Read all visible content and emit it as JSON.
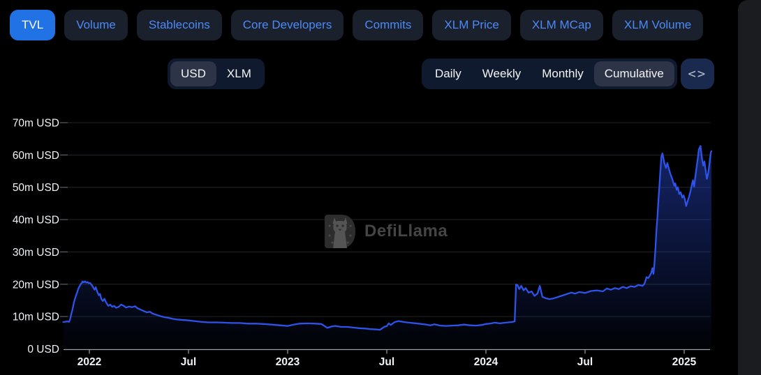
{
  "page": {
    "background": "#000000"
  },
  "tabs": [
    {
      "label": "TVL",
      "active": true
    },
    {
      "label": "Volume",
      "active": false
    },
    {
      "label": "Stablecoins",
      "active": false
    },
    {
      "label": "Core Developers",
      "active": false
    },
    {
      "label": "Commits",
      "active": false
    },
    {
      "label": "XLM Price",
      "active": false
    },
    {
      "label": "XLM MCap",
      "active": false
    },
    {
      "label": "XLM Volume",
      "active": false
    }
  ],
  "currency_toggle": {
    "options": [
      "USD",
      "XLM"
    ],
    "selected": "USD"
  },
  "interval_toggle": {
    "options": [
      "Daily",
      "Weekly",
      "Monthly",
      "Cumulative"
    ],
    "selected": "Cumulative"
  },
  "controls": {
    "expand_glyph": "<>"
  },
  "watermark": {
    "brand": "DefiLlama",
    "icon": "llama-icon"
  },
  "colors": {
    "accent": "#2172e5",
    "tab_text": "#4c8af6",
    "tab_bg": "#1b202d",
    "toggle_bg": "#101a2f",
    "selected_pill": "#2d3447",
    "expand_bg": "#1a2a4e",
    "line": "#2e53ea",
    "grid": "#20242b",
    "axis": "#99a0a8"
  },
  "chart_data": {
    "type": "line",
    "title": "Stellar TVL (Cumulative, USD)",
    "unit": "m USD",
    "ylim": [
      0,
      70
    ],
    "grid": "horizontal",
    "legend": "none",
    "y_ticks": [
      "0 USD",
      "10m USD",
      "20m USD",
      "30m USD",
      "40m USD",
      "50m USD",
      "60m USD",
      "70m USD"
    ],
    "x_ticks": [
      {
        "label": "2022",
        "t": 2022
      },
      {
        "label": "Jul",
        "t": 2022.5
      },
      {
        "label": "2023",
        "t": 2023
      },
      {
        "label": "Jul",
        "t": 2023.5
      },
      {
        "label": "2024",
        "t": 2024
      },
      {
        "label": "Jul",
        "t": 2024.5
      },
      {
        "label": "2025",
        "t": 2025
      }
    ],
    "series": [
      {
        "name": "TVL",
        "color": "#2e53ea",
        "points": [
          [
            2021.868,
            8.3
          ],
          [
            2021.878,
            8.4
          ],
          [
            2021.888,
            8.5
          ],
          [
            2021.898,
            8.4
          ],
          [
            2021.903,
            9.2
          ],
          [
            2021.908,
            10.6
          ],
          [
            2021.915,
            12.3
          ],
          [
            2021.922,
            14.3
          ],
          [
            2021.93,
            16.0
          ],
          [
            2021.938,
            17.4
          ],
          [
            2021.944,
            18.6
          ],
          [
            2021.95,
            19.3
          ],
          [
            2021.956,
            20.0
          ],
          [
            2021.962,
            20.4
          ],
          [
            2021.966,
            20.9
          ],
          [
            2021.972,
            20.6
          ],
          [
            2021.978,
            20.9
          ],
          [
            2021.984,
            20.5
          ],
          [
            2021.99,
            20.7
          ],
          [
            2021.996,
            20.3
          ],
          [
            2022.004,
            20.4
          ],
          [
            2022.01,
            19.9
          ],
          [
            2022.016,
            19.4
          ],
          [
            2022.02,
            18.9
          ],
          [
            2022.026,
            18.3
          ],
          [
            2022.032,
            19.1
          ],
          [
            2022.04,
            17.6
          ],
          [
            2022.048,
            16.6
          ],
          [
            2022.054,
            17.0
          ],
          [
            2022.06,
            15.5
          ],
          [
            2022.068,
            14.8
          ],
          [
            2022.076,
            15.5
          ],
          [
            2022.084,
            14.4
          ],
          [
            2022.095,
            13.3
          ],
          [
            2022.105,
            13.7
          ],
          [
            2022.115,
            13.0
          ],
          [
            2022.125,
            13.3
          ],
          [
            2022.135,
            12.7
          ],
          [
            2022.148,
            13.0
          ],
          [
            2022.16,
            13.7
          ],
          [
            2022.172,
            13.4
          ],
          [
            2022.185,
            12.8
          ],
          [
            2022.2,
            13.1
          ],
          [
            2022.215,
            12.9
          ],
          [
            2022.23,
            13.2
          ],
          [
            2022.245,
            12.5
          ],
          [
            2022.26,
            12.1
          ],
          [
            2022.275,
            11.7
          ],
          [
            2022.29,
            11.3
          ],
          [
            2022.305,
            11.5
          ],
          [
            2022.32,
            10.9
          ],
          [
            2022.34,
            10.5
          ],
          [
            2022.36,
            10.1
          ],
          [
            2022.38,
            9.8
          ],
          [
            2022.4,
            9.6
          ],
          [
            2022.42,
            9.3
          ],
          [
            2022.44,
            9.1
          ],
          [
            2022.46,
            9.0
          ],
          [
            2022.48,
            8.9
          ],
          [
            2022.5,
            8.8
          ],
          [
            2022.53,
            8.6
          ],
          [
            2022.56,
            8.4
          ],
          [
            2022.6,
            8.2
          ],
          [
            2022.64,
            8.2
          ],
          [
            2022.68,
            8.1
          ],
          [
            2022.72,
            8.0
          ],
          [
            2022.76,
            8.0
          ],
          [
            2022.8,
            7.8
          ],
          [
            2022.84,
            7.8
          ],
          [
            2022.88,
            7.7
          ],
          [
            2022.92,
            7.5
          ],
          [
            2022.96,
            7.3
          ],
          [
            2023.0,
            7.1
          ],
          [
            2023.03,
            7.5
          ],
          [
            2023.06,
            7.8
          ],
          [
            2023.1,
            7.9
          ],
          [
            2023.14,
            7.8
          ],
          [
            2023.17,
            7.7
          ],
          [
            2023.19,
            6.9
          ],
          [
            2023.2,
            6.5
          ],
          [
            2023.22,
            6.9
          ],
          [
            2023.24,
            7.1
          ],
          [
            2023.27,
            6.8
          ],
          [
            2023.3,
            6.8
          ],
          [
            2023.33,
            6.6
          ],
          [
            2023.36,
            6.4
          ],
          [
            2023.39,
            6.3
          ],
          [
            2023.42,
            6.1
          ],
          [
            2023.45,
            6.0
          ],
          [
            2023.465,
            5.9
          ],
          [
            2023.48,
            6.5
          ],
          [
            2023.49,
            6.9
          ],
          [
            2023.5,
            7.0
          ],
          [
            2023.51,
            7.9
          ],
          [
            2023.52,
            7.4
          ],
          [
            2023.54,
            8.3
          ],
          [
            2023.56,
            8.6
          ],
          [
            2023.58,
            8.4
          ],
          [
            2023.6,
            8.2
          ],
          [
            2023.63,
            8.0
          ],
          [
            2023.66,
            7.8
          ],
          [
            2023.69,
            7.6
          ],
          [
            2023.72,
            7.3
          ],
          [
            2023.74,
            7.6
          ],
          [
            2023.77,
            7.2
          ],
          [
            2023.8,
            7.1
          ],
          [
            2023.83,
            7.2
          ],
          [
            2023.86,
            7.3
          ],
          [
            2023.89,
            7.5
          ],
          [
            2023.92,
            7.3
          ],
          [
            2023.95,
            7.2
          ],
          [
            2023.98,
            7.4
          ],
          [
            2024.0,
            7.7
          ],
          [
            2024.02,
            7.8
          ],
          [
            2024.045,
            8.1
          ],
          [
            2024.07,
            7.9
          ],
          [
            2024.1,
            8.1
          ],
          [
            2024.13,
            8.3
          ],
          [
            2024.145,
            8.5
          ],
          [
            2024.152,
            19.9
          ],
          [
            2024.16,
            19.7
          ],
          [
            2024.168,
            18.5
          ],
          [
            2024.178,
            19.5
          ],
          [
            2024.19,
            18.1
          ],
          [
            2024.2,
            18.8
          ],
          [
            2024.215,
            17.4
          ],
          [
            2024.23,
            17.8
          ],
          [
            2024.245,
            16.4
          ],
          [
            2024.26,
            17.1
          ],
          [
            2024.272,
            19.5
          ],
          [
            2024.285,
            16.1
          ],
          [
            2024.3,
            15.7
          ],
          [
            2024.32,
            15.4
          ],
          [
            2024.34,
            15.6
          ],
          [
            2024.37,
            16.2
          ],
          [
            2024.4,
            16.8
          ],
          [
            2024.43,
            17.4
          ],
          [
            2024.45,
            17.1
          ],
          [
            2024.47,
            17.6
          ],
          [
            2024.5,
            17.3
          ],
          [
            2024.53,
            17.9
          ],
          [
            2024.56,
            18.1
          ],
          [
            2024.59,
            17.8
          ],
          [
            2024.61,
            18.7
          ],
          [
            2024.63,
            18.3
          ],
          [
            2024.65,
            18.8
          ],
          [
            2024.67,
            18.5
          ],
          [
            2024.69,
            19.2
          ],
          [
            2024.71,
            18.8
          ],
          [
            2024.73,
            19.4
          ],
          [
            2024.75,
            19.2
          ],
          [
            2024.77,
            19.8
          ],
          [
            2024.79,
            19.5
          ],
          [
            2024.8,
            20.2
          ],
          [
            2024.81,
            22.2
          ],
          [
            2024.818,
            21.9
          ],
          [
            2024.826,
            22.6
          ],
          [
            2024.834,
            23.6
          ],
          [
            2024.84,
            25.0
          ],
          [
            2024.845,
            23.2
          ],
          [
            2024.85,
            26.4
          ],
          [
            2024.855,
            31.0
          ],
          [
            2024.86,
            36.5
          ],
          [
            2024.865,
            41.0
          ],
          [
            2024.87,
            46.0
          ],
          [
            2024.875,
            50.5
          ],
          [
            2024.88,
            55.2
          ],
          [
            2024.885,
            59.5
          ],
          [
            2024.89,
            60.5
          ],
          [
            2024.9,
            57.5
          ],
          [
            2024.908,
            56.0
          ],
          [
            2024.915,
            57.5
          ],
          [
            2024.92,
            56.3
          ],
          [
            2024.93,
            54.2
          ],
          [
            2024.94,
            52.5
          ],
          [
            2024.95,
            50.5
          ],
          [
            2024.955,
            51.2
          ],
          [
            2024.962,
            49.2
          ],
          [
            2024.968,
            50.0
          ],
          [
            2024.975,
            47.9
          ],
          [
            2024.982,
            48.5
          ],
          [
            2024.99,
            46.8
          ],
          [
            2024.997,
            47.5
          ],
          [
            2025.003,
            46.3
          ],
          [
            2025.01,
            44.2
          ],
          [
            2025.018,
            45.8
          ],
          [
            2025.025,
            47.2
          ],
          [
            2025.032,
            48.9
          ],
          [
            2025.038,
            50.6
          ],
          [
            2025.044,
            52.2
          ],
          [
            2025.05,
            50.2
          ],
          [
            2025.056,
            53.2
          ],
          [
            2025.062,
            56.0
          ],
          [
            2025.068,
            58.7
          ],
          [
            2025.074,
            61.7
          ],
          [
            2025.082,
            62.8
          ],
          [
            2025.09,
            58.7
          ],
          [
            2025.096,
            56.7
          ],
          [
            2025.102,
            58.0
          ],
          [
            2025.108,
            55.3
          ],
          [
            2025.114,
            52.6
          ],
          [
            2025.12,
            54.0
          ],
          [
            2025.126,
            56.7
          ],
          [
            2025.131,
            59.4
          ],
          [
            2025.134,
            60.7
          ],
          [
            2025.137,
            61.2
          ]
        ]
      }
    ]
  }
}
